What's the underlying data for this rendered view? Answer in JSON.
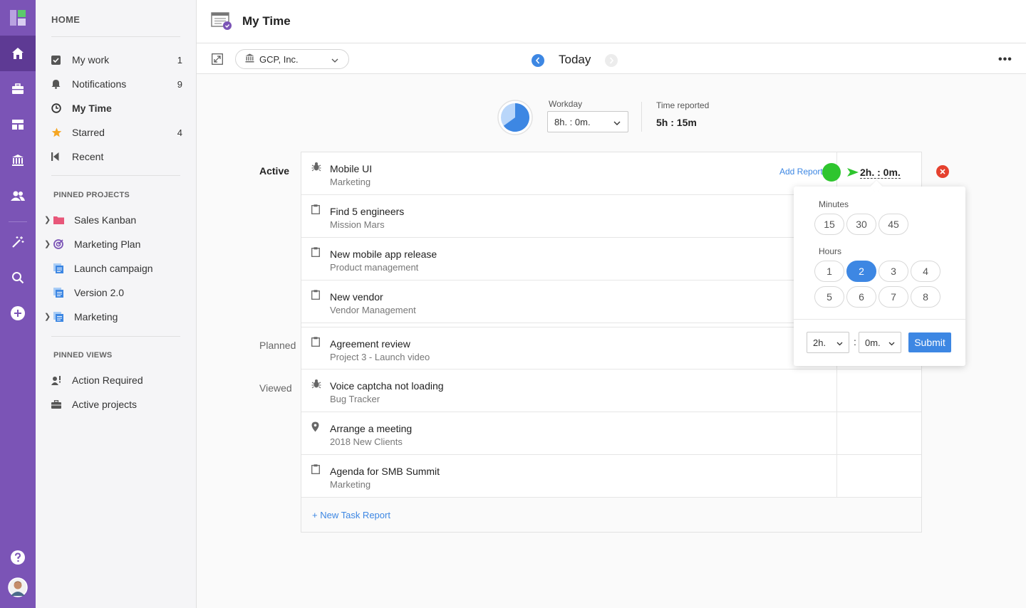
{
  "rail": {
    "items": [
      {
        "name": "logo"
      },
      {
        "name": "home"
      },
      {
        "name": "briefcase"
      },
      {
        "name": "dashboard"
      },
      {
        "name": "bank"
      },
      {
        "name": "users"
      },
      {
        "name": "magic-wand"
      },
      {
        "name": "search"
      },
      {
        "name": "add"
      },
      {
        "name": "help"
      },
      {
        "name": "avatar"
      }
    ]
  },
  "sidebar": {
    "home_label": "HOME",
    "nav": [
      {
        "label": "My work",
        "count": "1",
        "icon": "checkbox-icon"
      },
      {
        "label": "Notifications",
        "count": "9",
        "icon": "bell-icon"
      },
      {
        "label": "My Time",
        "count": "",
        "icon": "clock-icon"
      },
      {
        "label": "Starred",
        "count": "4",
        "icon": "star-icon"
      },
      {
        "label": "Recent",
        "count": "",
        "icon": "recent-icon"
      }
    ],
    "pinned_projects_label": "PINNED PROJECTS",
    "projects": [
      {
        "label": "Sales Kanban",
        "icon": "folder-icon",
        "color": "#e8577a"
      },
      {
        "label": "Marketing Plan",
        "icon": "target-icon",
        "color": "#7b54b6"
      },
      {
        "label": "Launch campaign",
        "icon": "document-icon",
        "color": "#3d87e3"
      },
      {
        "label": "Version 2.0",
        "icon": "document-icon",
        "color": "#3d87e3"
      },
      {
        "label": "Marketing",
        "icon": "document-icon",
        "color": "#3d87e3"
      }
    ],
    "pinned_views_label": "PINNED VIEWS",
    "views": [
      {
        "label": "Action Required",
        "icon": "user-alert-icon"
      },
      {
        "label": "Active projects",
        "icon": "briefcase-icon"
      }
    ]
  },
  "header": {
    "title": "My Time"
  },
  "toolbar": {
    "company": "GCP, Inc.",
    "date_label": "Today"
  },
  "summary": {
    "workday_label": "Workday",
    "workday_value": "8h. : 0m.",
    "reported_label": "Time reported",
    "reported_value": "5h : 15m",
    "reported_fraction": 0.65
  },
  "groups": {
    "active": "Active",
    "planned": "Planned",
    "viewed": "Viewed"
  },
  "tasks": [
    {
      "name": "Mobile UI",
      "project": "Marketing",
      "icon": "bug-icon"
    },
    {
      "name": "Find 5 engineers",
      "project": "Mission Mars",
      "icon": "clipboard-icon"
    },
    {
      "name": "New mobile app release",
      "project": "Product management",
      "icon": "clipboard-icon"
    },
    {
      "name": "New vendor",
      "project": "Vendor Management",
      "icon": "clipboard-icon"
    },
    {
      "name": "Agreement review",
      "project": "Project 3 - Launch video",
      "icon": "clipboard-icon"
    },
    {
      "name": "Voice captcha not loading",
      "project": "Bug Tracker",
      "icon": "bug-icon"
    },
    {
      "name": "Arrange a meeting",
      "project": "2018 New Clients",
      "icon": "pin-icon"
    },
    {
      "name": "Agenda for SMB Summit",
      "project": "Marketing",
      "icon": "clipboard-icon"
    }
  ],
  "active_row": {
    "add_report": "Add Report",
    "time": "2h. : 0m."
  },
  "new_task": "+ New Task Report",
  "popover": {
    "minutes_label": "Minutes",
    "minutes": [
      "15",
      "30",
      "45"
    ],
    "hours_label": "Hours",
    "hours": [
      "1",
      "2",
      "3",
      "4",
      "5",
      "6",
      "7",
      "8"
    ],
    "selected_hour": "2",
    "hour_select": "2h.",
    "minute_select": "0m.",
    "separator": ":",
    "submit": "Submit"
  },
  "colors": {
    "accent": "#3d87e3",
    "rail": "#7b54b6",
    "danger": "#e5412e",
    "indicator": "#2ec52e"
  }
}
